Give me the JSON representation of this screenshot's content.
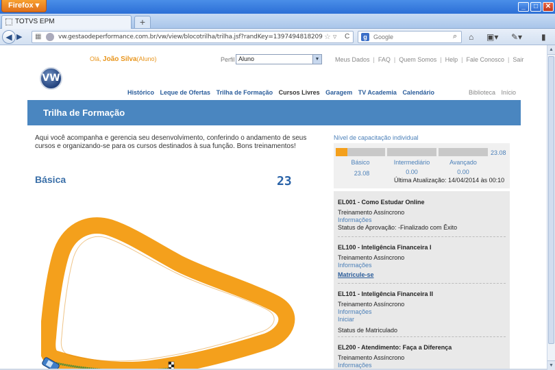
{
  "browser": {
    "app_button": "Firefox",
    "tab_title": "TOTVS EPM",
    "new_tab": "+",
    "url": "vw.gestaodeperformance.com.br/vw/view/blocotrilha/trilha.jsf?randKey=1397494818209",
    "search_engine": "Google",
    "search_placeholder": "Google"
  },
  "header": {
    "greeting_prefix": "Olá,",
    "user_name": "João Silva",
    "user_role": "(Aluno)",
    "perfil_label": "Perfil",
    "perfil_value": "Aluno",
    "top_links": [
      "Meus Dados",
      "FAQ",
      "Quem Somos",
      "Help",
      "Fale Conosco",
      "Sair"
    ],
    "logo_text": "VW",
    "main_nav": [
      "Histórico",
      "Leque de Ofertas",
      "Trilha de Formação",
      "Cursos Livres",
      "Garagem",
      "TV Academia",
      "Calendário"
    ],
    "active_nav": "Cursos Livres",
    "right_nav": [
      "Biblioteca",
      "Início"
    ]
  },
  "banner": {
    "title": "Trilha de Formação"
  },
  "intro": "Aqui você acompanha e gerencia seu desenvolvimento, conferindo o andamento de seus cursos e organizando-se para os cursos destinados à sua função. Bons treinamentos!",
  "level": {
    "title": "Nível de capacitação individual",
    "total": "23.08",
    "levels": [
      {
        "name": "Básico",
        "value": "23.08",
        "fill": 0.23
      },
      {
        "name": "Intermediário",
        "value": "0.00",
        "fill": 0
      },
      {
        "name": "Avançado",
        "value": "0.00",
        "fill": 0
      }
    ],
    "last_update": "Última Atualização: 14/04/2014 às 00:10"
  },
  "track": {
    "level_name": "Básica",
    "score": "23"
  },
  "courses": [
    {
      "code": "EL001 - Como Estudar Online",
      "type": "Treinamento Assíncrono",
      "link": "Informações",
      "status": "Status de Aprovação: -Finalizado com Êxito",
      "action": ""
    },
    {
      "code": "EL100 - Inteligência Financeira I",
      "type": "Treinamento Assíncrono",
      "link": "Informações",
      "status": "",
      "action": "Matricule-se"
    },
    {
      "code": "EL101 - Inteligência Financeira II",
      "type": "Treinamento Assíncrono",
      "link": "Informações",
      "status": "Status de Matriculado",
      "action": "Iniciar"
    },
    {
      "code": "EL200 - Atendimento: Faça a Diferença",
      "type": "Treinamento Assíncrono",
      "link": "Informações",
      "status": "",
      "action": ""
    }
  ],
  "colors": {
    "accent": "#4a86c0",
    "track": "#f4a01c",
    "greeting": "#e8941a",
    "link": "#4a7fb8"
  }
}
